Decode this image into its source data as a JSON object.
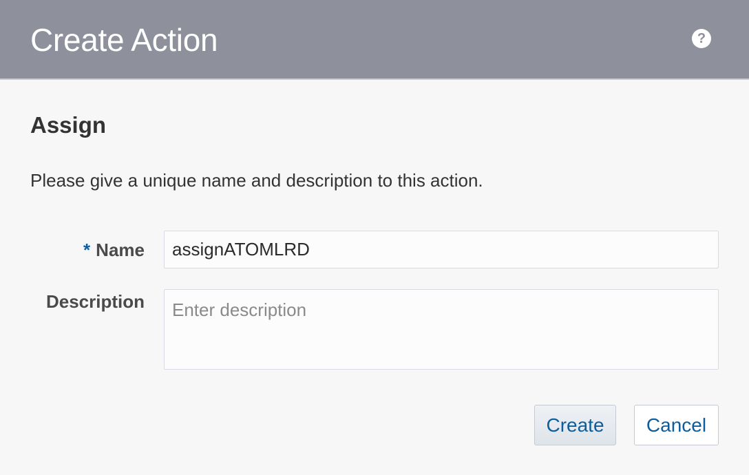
{
  "dialog": {
    "title": "Create Action",
    "help_icon": "question-circle-icon",
    "help_glyph": "?"
  },
  "section": {
    "title": "Assign",
    "instructions": "Please give a unique name and description to this action."
  },
  "form": {
    "name": {
      "required_marker": "*",
      "label": "Name",
      "value": "assignATOMLRD"
    },
    "description": {
      "label": "Description",
      "value": "",
      "placeholder": "Enter description"
    }
  },
  "buttons": {
    "create_label": "Create",
    "cancel_label": "Cancel"
  },
  "colors": {
    "titlebar": "#8e909c",
    "accent": "#0c5d9c",
    "required": "#0b5fa5"
  }
}
